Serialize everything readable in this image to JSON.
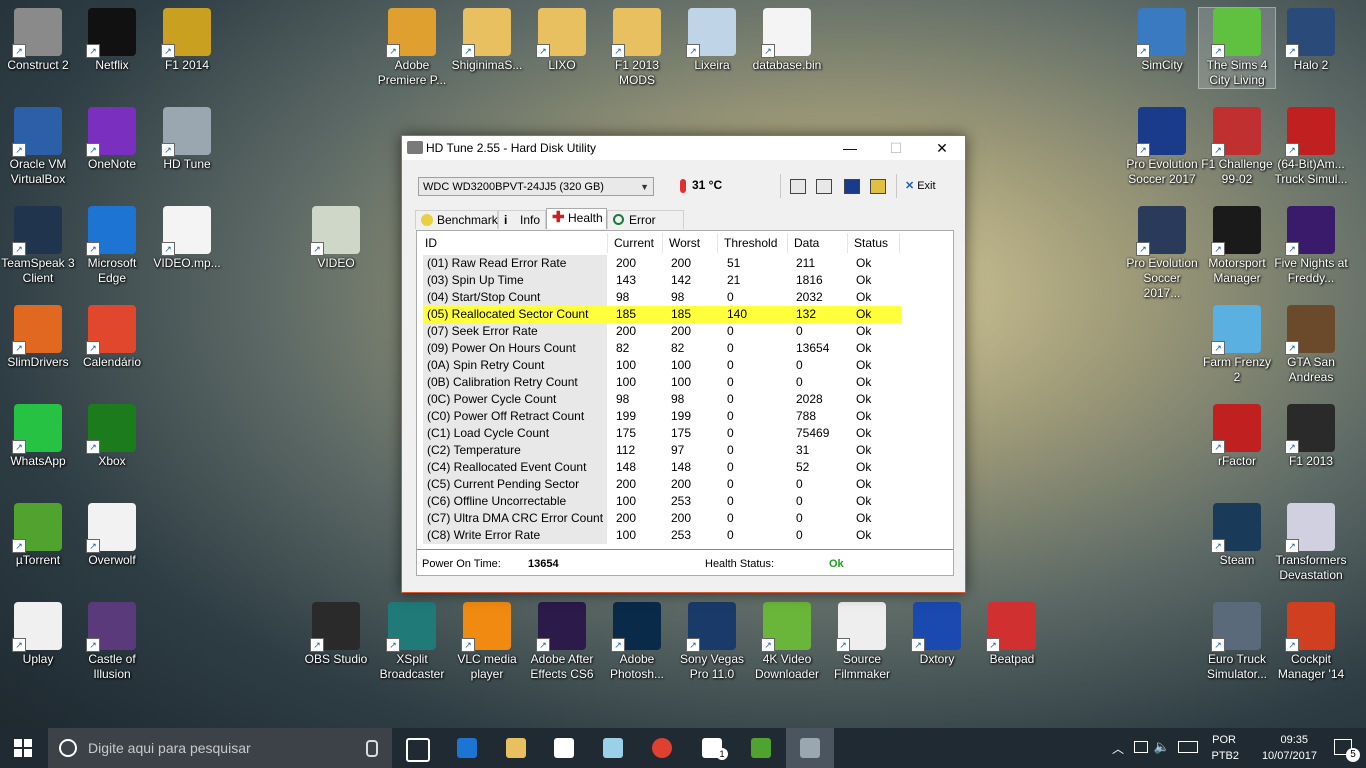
{
  "desktop_left": [
    {
      "label": "Construct 2",
      "icon": "construct-icon",
      "color": "#8a8a8a"
    },
    {
      "label": "Netflix",
      "icon": "netflix-icon",
      "color": "#111111"
    },
    {
      "label": "F1 2014",
      "icon": "f1-2014-icon",
      "color": "#c9a020"
    },
    {
      "label": "Oracle VM VirtualBox",
      "icon": "virtualbox-icon",
      "color": "#2b5fa8"
    },
    {
      "label": "OneNote",
      "icon": "onenote-icon",
      "color": "#7b2fbf"
    },
    {
      "label": "HD Tune",
      "icon": "hdtune-icon",
      "color": "#9aa6b0"
    },
    {
      "label": "TeamSpeak 3 Client",
      "icon": "teamspeak-icon",
      "color": "#20344d"
    },
    {
      "label": "Microsoft Edge",
      "icon": "edge-icon",
      "color": "#1d74d3"
    },
    {
      "label": "VIDEO.mp...",
      "icon": "file-icon",
      "color": "#f4f4f4"
    },
    {
      "label": "VIDEO",
      "icon": "phone-icon",
      "color": "#cfd8c8"
    },
    {
      "label": "SlimDrivers",
      "icon": "slimdrivers-icon",
      "color": "#e06820"
    },
    {
      "label": "Calendário",
      "icon": "calendar-icon",
      "color": "#e0472c"
    },
    {
      "label": "WhatsApp",
      "icon": "whatsapp-icon",
      "color": "#25c244"
    },
    {
      "label": "Xbox",
      "icon": "xbox-icon",
      "color": "#1c7b1c"
    },
    {
      "label": "µTorrent",
      "icon": "utorrent-icon",
      "color": "#4fa32e"
    },
    {
      "label": "Overwolf",
      "icon": "overwolf-icon",
      "color": "#f2f2f2"
    },
    {
      "label": "Uplay",
      "icon": "uplay-icon",
      "color": "#f0f0f0"
    },
    {
      "label": "Castle of Illusion",
      "icon": "castle-icon",
      "color": "#5a3a7a"
    }
  ],
  "desktop_top": [
    {
      "label": "Adobe Premiere P...",
      "icon": "premiere-disc-icon",
      "color": "#e0a030"
    },
    {
      "label": "ShiginimaS...",
      "icon": "folder-icon",
      "color": "#e8c060"
    },
    {
      "label": "LIXO",
      "icon": "folder-icon",
      "color": "#e8c060"
    },
    {
      "label": "F1 2013 MODS",
      "icon": "folder-icon",
      "color": "#e8c060"
    },
    {
      "label": "Lixeira",
      "icon": "recycle-bin-icon",
      "color": "#c0d4e8"
    },
    {
      "label": "database.bin",
      "icon": "file-icon",
      "color": "#f4f4f4"
    }
  ],
  "desktop_bottom": [
    {
      "label": "OBS Studio",
      "icon": "obs-icon",
      "color": "#2a2a2a"
    },
    {
      "label": "XSplit Broadcaster",
      "icon": "xsplit-icon",
      "color": "#1f7a78"
    },
    {
      "label": "VLC media player",
      "icon": "vlc-icon",
      "color": "#f08a10"
    },
    {
      "label": "Adobe After Effects CS6",
      "icon": "after-effects-icon",
      "color": "#2b1a4a"
    },
    {
      "label": "Adobe Photosh...",
      "icon": "photoshop-icon",
      "color": "#0a2a4a"
    },
    {
      "label": "Sony Vegas Pro 11.0",
      "icon": "vegas-icon",
      "color": "#1a3a6a"
    },
    {
      "label": "4K Video Downloader",
      "icon": "4k-downloader-icon",
      "color": "#6ab63a"
    },
    {
      "label": "Source Filmmaker",
      "icon": "sfm-icon",
      "color": "#eeeeee"
    },
    {
      "label": "Dxtory",
      "icon": "dxtory-icon",
      "color": "#1a4ab0"
    },
    {
      "label": "Beatpad",
      "icon": "beatpad-icon",
      "color": "#d03030"
    }
  ],
  "desktop_right": [
    {
      "label": "SimCity",
      "icon": "simcity-icon",
      "color": "#3a7ac0"
    },
    {
      "label": "The Sims 4 City Living",
      "icon": "sims-icon",
      "color": "#60c040"
    },
    {
      "label": "Halo 2",
      "icon": "halo-icon",
      "color": "#2a4a7a"
    },
    {
      "label": "Pro Evolution Soccer 2017",
      "icon": "pes-icon",
      "color": "#1a3a8a"
    },
    {
      "label": "F1 Challenge 99-02",
      "icon": "f1-challenge-icon",
      "color": "#c03030"
    },
    {
      "label": "(64-Bit)Am... Truck Simul...",
      "icon": "ats-icon",
      "color": "#c02020"
    },
    {
      "label": "Pro Evolution Soccer 2017...",
      "icon": "pes-settings-icon",
      "color": "#2a3a5a"
    },
    {
      "label": "Motorsport Manager",
      "icon": "motorsport-icon",
      "color": "#1a1a1a"
    },
    {
      "label": "Five Nights at Freddy...",
      "icon": "fnaf-icon",
      "color": "#3a1a6a"
    },
    {
      "label": "Farm Frenzy 2",
      "icon": "farm-frenzy-icon",
      "color": "#5ab0e0"
    },
    {
      "label": "GTA San Andreas",
      "icon": "gta-icon",
      "color": "#6a4a2a"
    },
    {
      "label": "rFactor",
      "icon": "rfactor-icon",
      "color": "#c02020"
    },
    {
      "label": "F1 2013",
      "icon": "f1-2013-icon",
      "color": "#2a2a2a"
    },
    {
      "label": "Steam",
      "icon": "steam-icon",
      "color": "#1a3a5a"
    },
    {
      "label": "Transformers Devastation",
      "icon": "transformers-icon",
      "color": "#d0d0e0"
    },
    {
      "label": "Euro Truck Simulator...",
      "icon": "ets-icon",
      "color": "#5a6a7a"
    },
    {
      "label": "Cockpit Manager '14",
      "icon": "cockpit-icon",
      "color": "#d04020"
    }
  ],
  "window": {
    "title": "HD Tune 2.55 - Hard Disk Utility",
    "minimize": "—",
    "maximize": "☐",
    "close": "✕",
    "drive_select": "WDC     WD3200BPVT-24JJ5 (320 GB)",
    "temperature": "31 °C",
    "exit_label": "Exit",
    "tabs": [
      "Benchmark",
      "Info",
      "Health",
      "Error Scan"
    ],
    "active_tab": "Health",
    "columns": [
      "ID",
      "Current",
      "Worst",
      "Threshold",
      "Data",
      "Status"
    ],
    "rows": [
      [
        "(01) Raw Read Error Rate",
        "200",
        "200",
        "51",
        "211",
        "Ok"
      ],
      [
        "(03) Spin Up Time",
        "143",
        "142",
        "21",
        "1816",
        "Ok"
      ],
      [
        "(04) Start/Stop Count",
        "98",
        "98",
        "0",
        "2032",
        "Ok"
      ],
      [
        "(05) Reallocated Sector Count",
        "185",
        "185",
        "140",
        "132",
        "Ok"
      ],
      [
        "(07) Seek Error Rate",
        "200",
        "200",
        "0",
        "0",
        "Ok"
      ],
      [
        "(09) Power On Hours Count",
        "82",
        "82",
        "0",
        "13654",
        "Ok"
      ],
      [
        "(0A) Spin Retry Count",
        "100",
        "100",
        "0",
        "0",
        "Ok"
      ],
      [
        "(0B) Calibration Retry Count",
        "100",
        "100",
        "0",
        "0",
        "Ok"
      ],
      [
        "(0C) Power Cycle Count",
        "98",
        "98",
        "0",
        "2028",
        "Ok"
      ],
      [
        "(C0) Power Off Retract Count",
        "199",
        "199",
        "0",
        "788",
        "Ok"
      ],
      [
        "(C1) Load Cycle Count",
        "175",
        "175",
        "0",
        "75469",
        "Ok"
      ],
      [
        "(C2) Temperature",
        "112",
        "97",
        "0",
        "31",
        "Ok"
      ],
      [
        "(C4) Reallocated Event Count",
        "148",
        "148",
        "0",
        "52",
        "Ok"
      ],
      [
        "(C5) Current Pending Sector",
        "200",
        "200",
        "0",
        "0",
        "Ok"
      ],
      [
        "(C6) Offline Uncorrectable",
        "100",
        "253",
        "0",
        "0",
        "Ok"
      ],
      [
        "(C7) Ultra DMA CRC Error Count",
        "200",
        "200",
        "0",
        "0",
        "Ok"
      ],
      [
        "(C8) Write Error Rate",
        "100",
        "253",
        "0",
        "0",
        "Ok"
      ]
    ],
    "highlight_row_index": 3,
    "highlight_color": "#ffff3c",
    "power_on_label": "Power On Time:",
    "power_on_value": "13654",
    "health_label": "Health Status:",
    "health_value": "Ok",
    "health_color": "#1ea01e"
  },
  "taskbar": {
    "search_placeholder": "Digite aqui para pesquisar",
    "apps": [
      "task-view-icon",
      "edge-icon",
      "file-explorer-icon",
      "store-icon",
      "sticky-icon",
      "chrome-icon",
      "mail-icon",
      "utorrent-icon",
      "hdtune-icon"
    ],
    "mail_badge": "1",
    "lang_1": "POR",
    "lang_2": "PTB2",
    "time": "09:35",
    "date": "10/07/2017",
    "notification_count": "5"
  }
}
